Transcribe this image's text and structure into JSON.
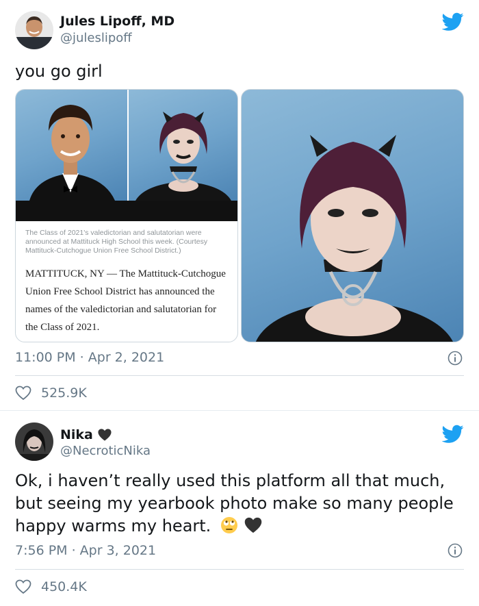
{
  "tweets": [
    {
      "author": {
        "name": "Jules Lipoff, MD",
        "handle": "@juleslipoff"
      },
      "text": "you go girl",
      "media": {
        "caption": "The Class of 2021's valedictorian and salutatorian were announced at Mattituck High School this week. (Courtesy Mattituck-Cutchogue Union Free School District.)",
        "article": "MATTITUCK, NY — The Mattituck-Cutchogue Union Free School District has announced the names of the valedictorian and salutatorian for the Class of 2021."
      },
      "time": "11:00 PM · Apr 2, 2021",
      "likes": "525.9K"
    },
    {
      "author": {
        "name": "Nika",
        "handle": "@NecroticNika",
        "name_badge": "black-heart-icon"
      },
      "text": "Ok, i haven’t really used this platform all that much, but seeing my yearbook photo make so many people happy warms my heart.",
      "emojis": [
        "rolling-eyes-emoji",
        "black-heart-icon"
      ],
      "time": "7:56 PM · Apr 3, 2021",
      "likes": "450.4K"
    }
  ],
  "colors": {
    "twitter_blue": "#1da1f2",
    "secondary_text": "#657786",
    "primary_text": "#14171a"
  }
}
